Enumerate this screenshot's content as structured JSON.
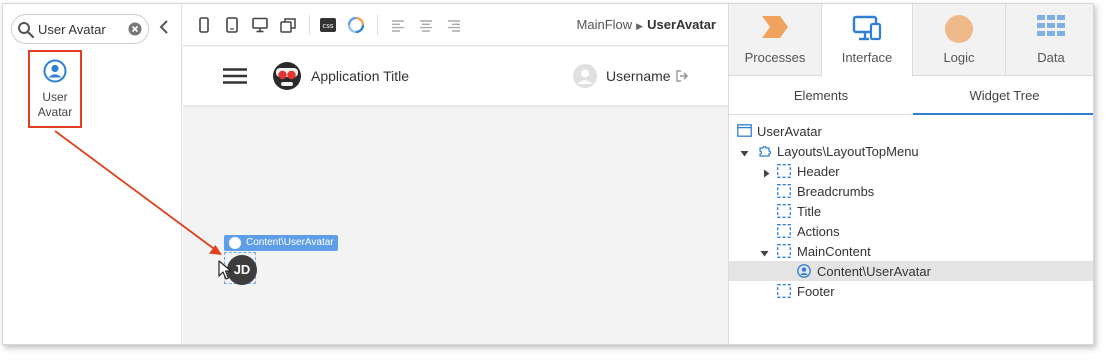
{
  "toolbox": {
    "search_value": "User Avatar",
    "widget_label_line1": "User",
    "widget_label_line2": "Avatar"
  },
  "canvas_toolbar": {
    "css_label": "css",
    "breadcrumb_parent": "MainFlow",
    "breadcrumb_current": "UserAvatar"
  },
  "app_header": {
    "title": "Application Title",
    "username": "Username"
  },
  "canvas": {
    "drop_tag": "Content\\UserAvatar",
    "avatar_initials": "JD"
  },
  "right_panel": {
    "tabs": [
      {
        "label": "Processes",
        "icon": "processes-icon",
        "color": "#f0a35e"
      },
      {
        "label": "Interface",
        "icon": "interface-icon",
        "color": "#2f7fd6"
      },
      {
        "label": "Logic",
        "icon": "logic-icon",
        "color": "#f0b98a"
      },
      {
        "label": "Data",
        "icon": "data-icon",
        "color": "#7fb0e6"
      }
    ],
    "subtabs": [
      "Elements",
      "Widget Tree"
    ],
    "tree": [
      {
        "label": "UserAvatar",
        "icon": "screen-icon"
      },
      {
        "label": "Layouts\\LayoutTopMenu",
        "icon": "block-icon"
      },
      {
        "label": "Header",
        "icon": "placeholder-icon"
      },
      {
        "label": "Breadcrumbs",
        "icon": "placeholder-icon"
      },
      {
        "label": "Title",
        "icon": "placeholder-icon"
      },
      {
        "label": "Actions",
        "icon": "placeholder-icon"
      },
      {
        "label": "MainContent",
        "icon": "placeholder-icon"
      },
      {
        "label": "Content\\UserAvatar",
        "icon": "user-avatar-icon"
      },
      {
        "label": "Footer",
        "icon": "placeholder-icon"
      }
    ]
  },
  "colors": {
    "accent": "#2f7fd6",
    "highlight_border": "#e0401f",
    "drop_tag": "#5e9ee8"
  }
}
